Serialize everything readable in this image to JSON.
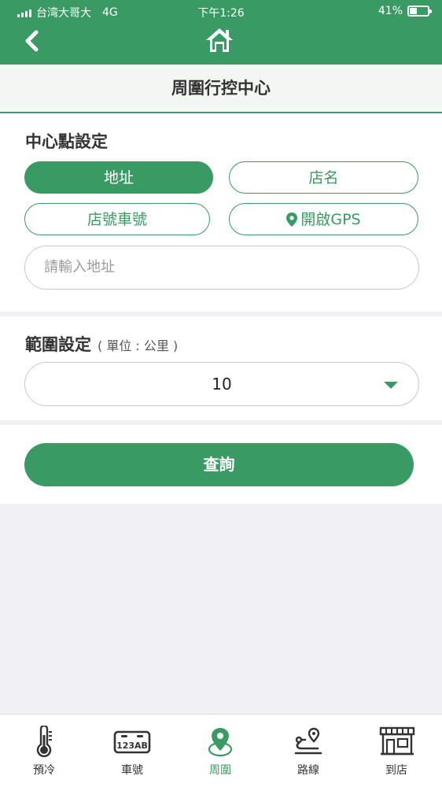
{
  "status_bar": {
    "carrier": "台湾大哥大",
    "network": "4G",
    "time": "下午1:26",
    "battery": "41%",
    "battery_level": 0.41
  },
  "nav": {
    "back_icon": "chevron-left-icon",
    "home_icon": "home-icon"
  },
  "page_title": "周圍行控中心",
  "center_section": {
    "title": "中心點設定",
    "options": {
      "address": "地址",
      "store_name": "店名",
      "store_vehicle": "店號車號",
      "gps": "開啟GPS"
    },
    "selected": "地址",
    "address_placeholder": "請輸入地址"
  },
  "range_section": {
    "title": "範圍設定",
    "unit_note": "( 單位 : 公里 )",
    "selected_value": "10"
  },
  "query_button": "查詢",
  "tabs": [
    {
      "label": "預冷",
      "icon": "thermometer-icon",
      "active": false
    },
    {
      "label": "車號",
      "icon": "license-plate-icon",
      "active": false
    },
    {
      "label": "周圍",
      "icon": "location-pin-icon",
      "active": true
    },
    {
      "label": "路線",
      "icon": "route-icon",
      "active": false
    },
    {
      "label": "到店",
      "icon": "store-icon",
      "active": false
    }
  ],
  "plate_icon_text": "123AB",
  "colors": {
    "brand_green": "#3a9a63",
    "background": "#f1f1f5",
    "placeholder": "#9a9a9a"
  }
}
